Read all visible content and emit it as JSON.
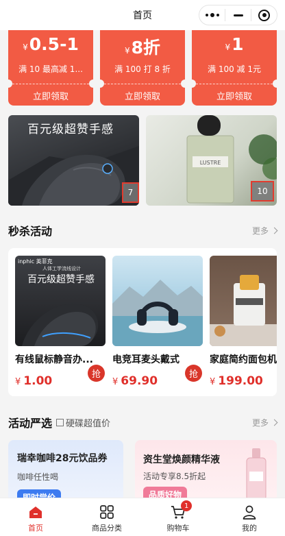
{
  "nav": {
    "title": "首页"
  },
  "coupons": [
    {
      "currency": "¥",
      "value": "0.5-1",
      "condition": "满 10 最高减 1...",
      "action": "立即领取"
    },
    {
      "currency": "¥",
      "value": "8折",
      "condition": "满 100 打 8 折",
      "action": "立即领取"
    },
    {
      "currency": "¥",
      "value": "1",
      "condition": "满 100 减 1元",
      "action": "立即领取"
    }
  ],
  "banners": [
    {
      "caption": "百元级超赞手感",
      "badge": "7"
    },
    {
      "caption": "",
      "badge": "10"
    }
  ],
  "flash_sale": {
    "title": "秒杀活动",
    "more": "更多",
    "grab_label": "抢",
    "products": [
      {
        "name": "有线鼠标静音办...",
        "currency": "¥",
        "price": "1.00",
        "image_caption": "百元级超赞手感",
        "image_brand": "inphic 英菲克",
        "image_slogan": "人体工学流线设计"
      },
      {
        "name": "电竞耳麦头戴式",
        "currency": "¥",
        "price": "69.90"
      },
      {
        "name": "家庭简约面包机",
        "currency": "¥",
        "price": "199.00"
      }
    ]
  },
  "activity": {
    "title": "活动严选",
    "subtitle": "硬碟超值价",
    "more": "更多",
    "cards": [
      {
        "title": "瑞幸咖啡28元饮品券",
        "subtitle": "咖啡任性喝",
        "button": "即时尝价"
      },
      {
        "title": "资生堂焕颜精华液",
        "subtitle": "活动专享8.5折起",
        "button": "品质好物"
      }
    ]
  },
  "tabbar": {
    "items": [
      {
        "label": "首页",
        "icon": "home-icon",
        "active": true
      },
      {
        "label": "商品分类",
        "icon": "grid-icon",
        "active": false
      },
      {
        "label": "购物车",
        "icon": "cart-icon",
        "active": false,
        "badge": "1"
      },
      {
        "label": "我的",
        "icon": "user-icon",
        "active": false
      }
    ]
  },
  "colors": {
    "accent": "#f25b44",
    "price": "#e0302b"
  }
}
